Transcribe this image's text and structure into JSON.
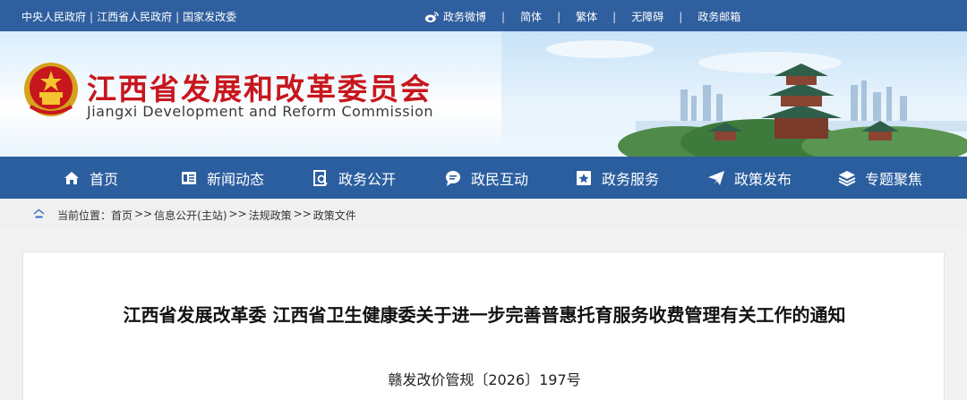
{
  "topbar": {
    "links": [
      "中央人民政府",
      "江西省人民政府",
      "国家发改委"
    ],
    "separator": "|",
    "weibo": "政务微博",
    "simplified": "简体",
    "traditional": "繁体",
    "accessibility": "无障碍",
    "mail": "政务邮箱"
  },
  "header": {
    "title": "江西省发展和改革委员会",
    "subtitle": "Jiangxi Development and Reform Commission"
  },
  "nav": {
    "items": [
      {
        "label": "首页",
        "icon": "home-icon"
      },
      {
        "label": "新闻动态",
        "icon": "news-icon"
      },
      {
        "label": "政务公开",
        "icon": "document-search-icon"
      },
      {
        "label": "政民互动",
        "icon": "chat-icon"
      },
      {
        "label": "政务服务",
        "icon": "star-service-icon"
      },
      {
        "label": "政策发布",
        "icon": "paper-plane-icon"
      },
      {
        "label": "专题聚焦",
        "icon": "layers-icon"
      }
    ]
  },
  "breadcrumb": {
    "prefix": "当前位置：",
    "items": [
      "首页",
      "信息公开(主站)",
      "法规政策",
      "政策文件"
    ],
    "sep": ">>"
  },
  "article": {
    "title": "江西省发展改革委 江西省卫生健康委关于进一步完善普惠托育服务收费管理有关工作的通知",
    "doc_number": "赣发改价管规〔2026〕197号"
  },
  "colors": {
    "nav_blue": "#2b5e9f",
    "title_red": "#c8161d"
  }
}
